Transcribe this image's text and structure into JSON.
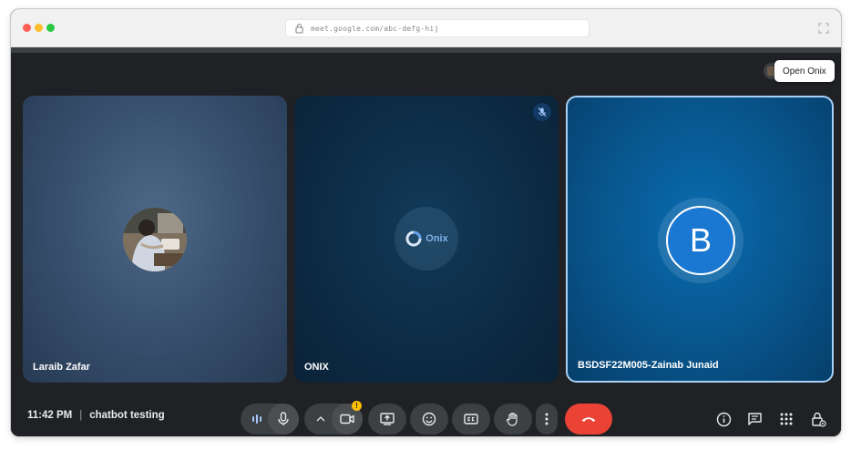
{
  "browser": {
    "url": "meet.google.com/abc-defg-hij"
  },
  "extension": {
    "tooltip": "Open Onix"
  },
  "participants": [
    {
      "name": "Laraib Zafar",
      "avatar_type": "photo"
    },
    {
      "name": "ONIX",
      "avatar_type": "logo",
      "logo_text": "Onix",
      "muted": true
    },
    {
      "name": "BSDSF22M005-Zainab Junaid",
      "avatar_type": "initial",
      "initial": "B",
      "active_speaker": true
    }
  ],
  "meeting": {
    "time": "11:42 PM",
    "separator": "|",
    "title": "chatbot testing"
  },
  "controls": {
    "camera_warning": "!",
    "icons": [
      "audio-levels-icon",
      "microphone-icon",
      "chevron-up-icon",
      "camera-icon",
      "present-screen-icon",
      "emoji-icon",
      "captions-icon",
      "raise-hand-icon",
      "more-options-icon",
      "end-call-icon"
    ],
    "right_icons": [
      "info-icon",
      "chat-icon",
      "activities-icon",
      "host-controls-icon"
    ]
  },
  "colors": {
    "end_call": "#ea4335",
    "active_border": "#a8d1f5",
    "avatar_blue": "#1a78d2",
    "control_bg": "#3c4043",
    "meet_bg": "#202124"
  }
}
